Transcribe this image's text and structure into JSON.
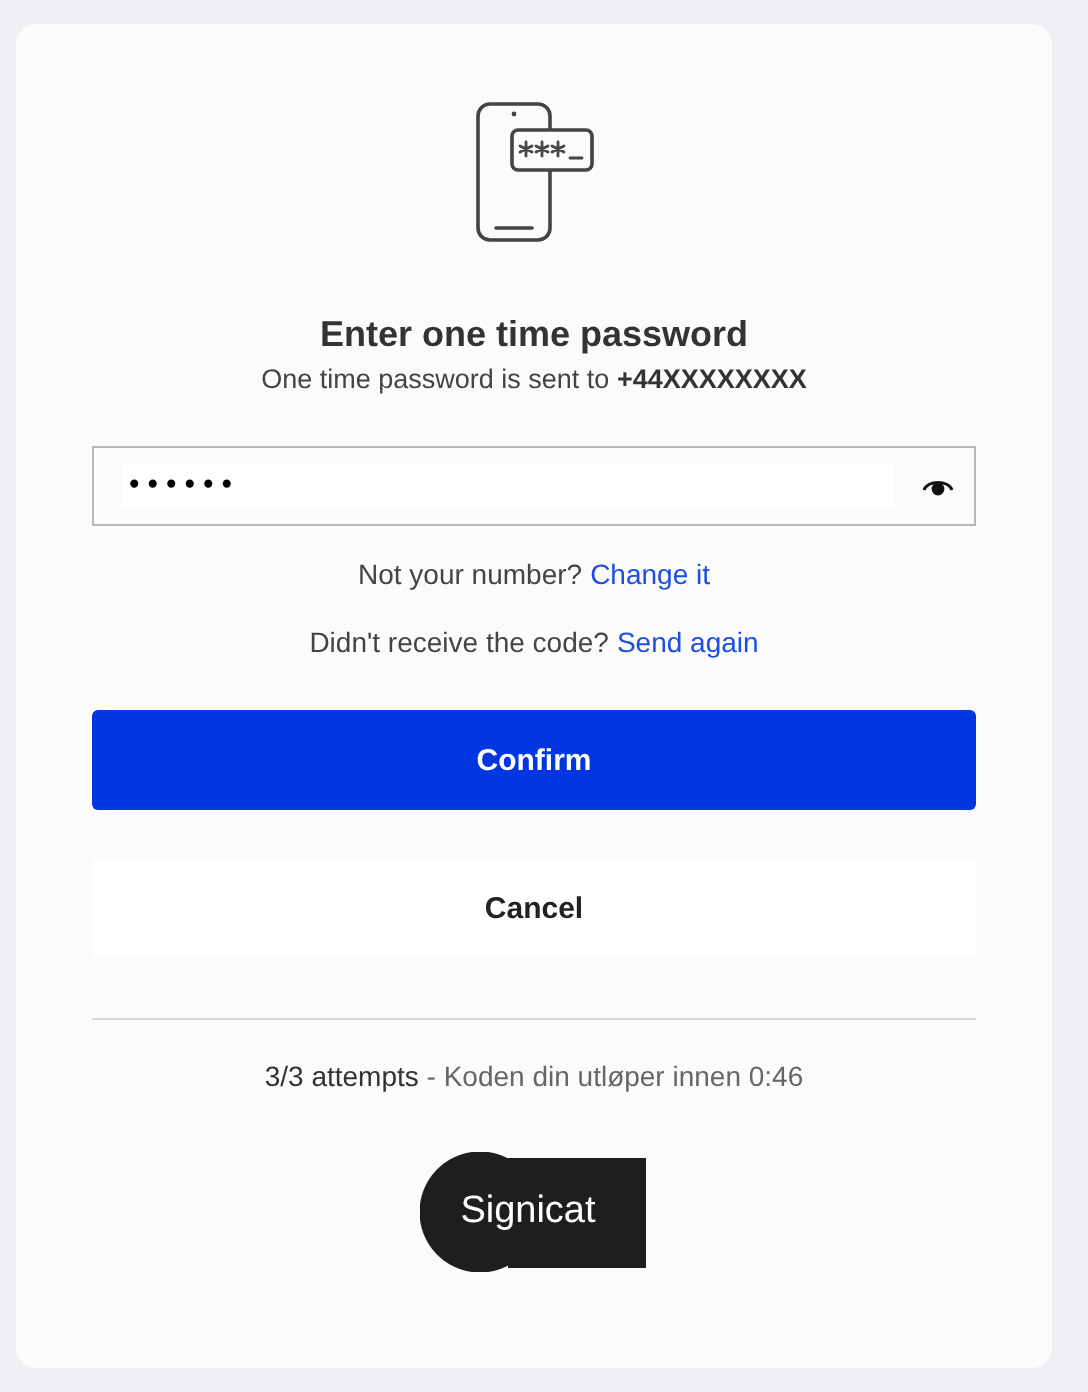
{
  "title": "Enter one time password",
  "subtitle": {
    "text": "One time password is sent to ",
    "number": "+44XXXXXXXX"
  },
  "password_field": {
    "value": "••••••",
    "masked": true
  },
  "links": [
    {
      "prompt": "Not your number?",
      "link": "Change it"
    },
    {
      "prompt": "Didn't receive the code?",
      "link": "Send again"
    }
  ],
  "buttons": [
    {
      "label": "Confirm",
      "kind": "primary"
    },
    {
      "label": "Cancel",
      "kind": "secondary"
    }
  ],
  "footer": {
    "attempts": "3/3 attempts",
    "expiry": " - Koden din utløper innen 0:46"
  },
  "logo": "Signicat"
}
